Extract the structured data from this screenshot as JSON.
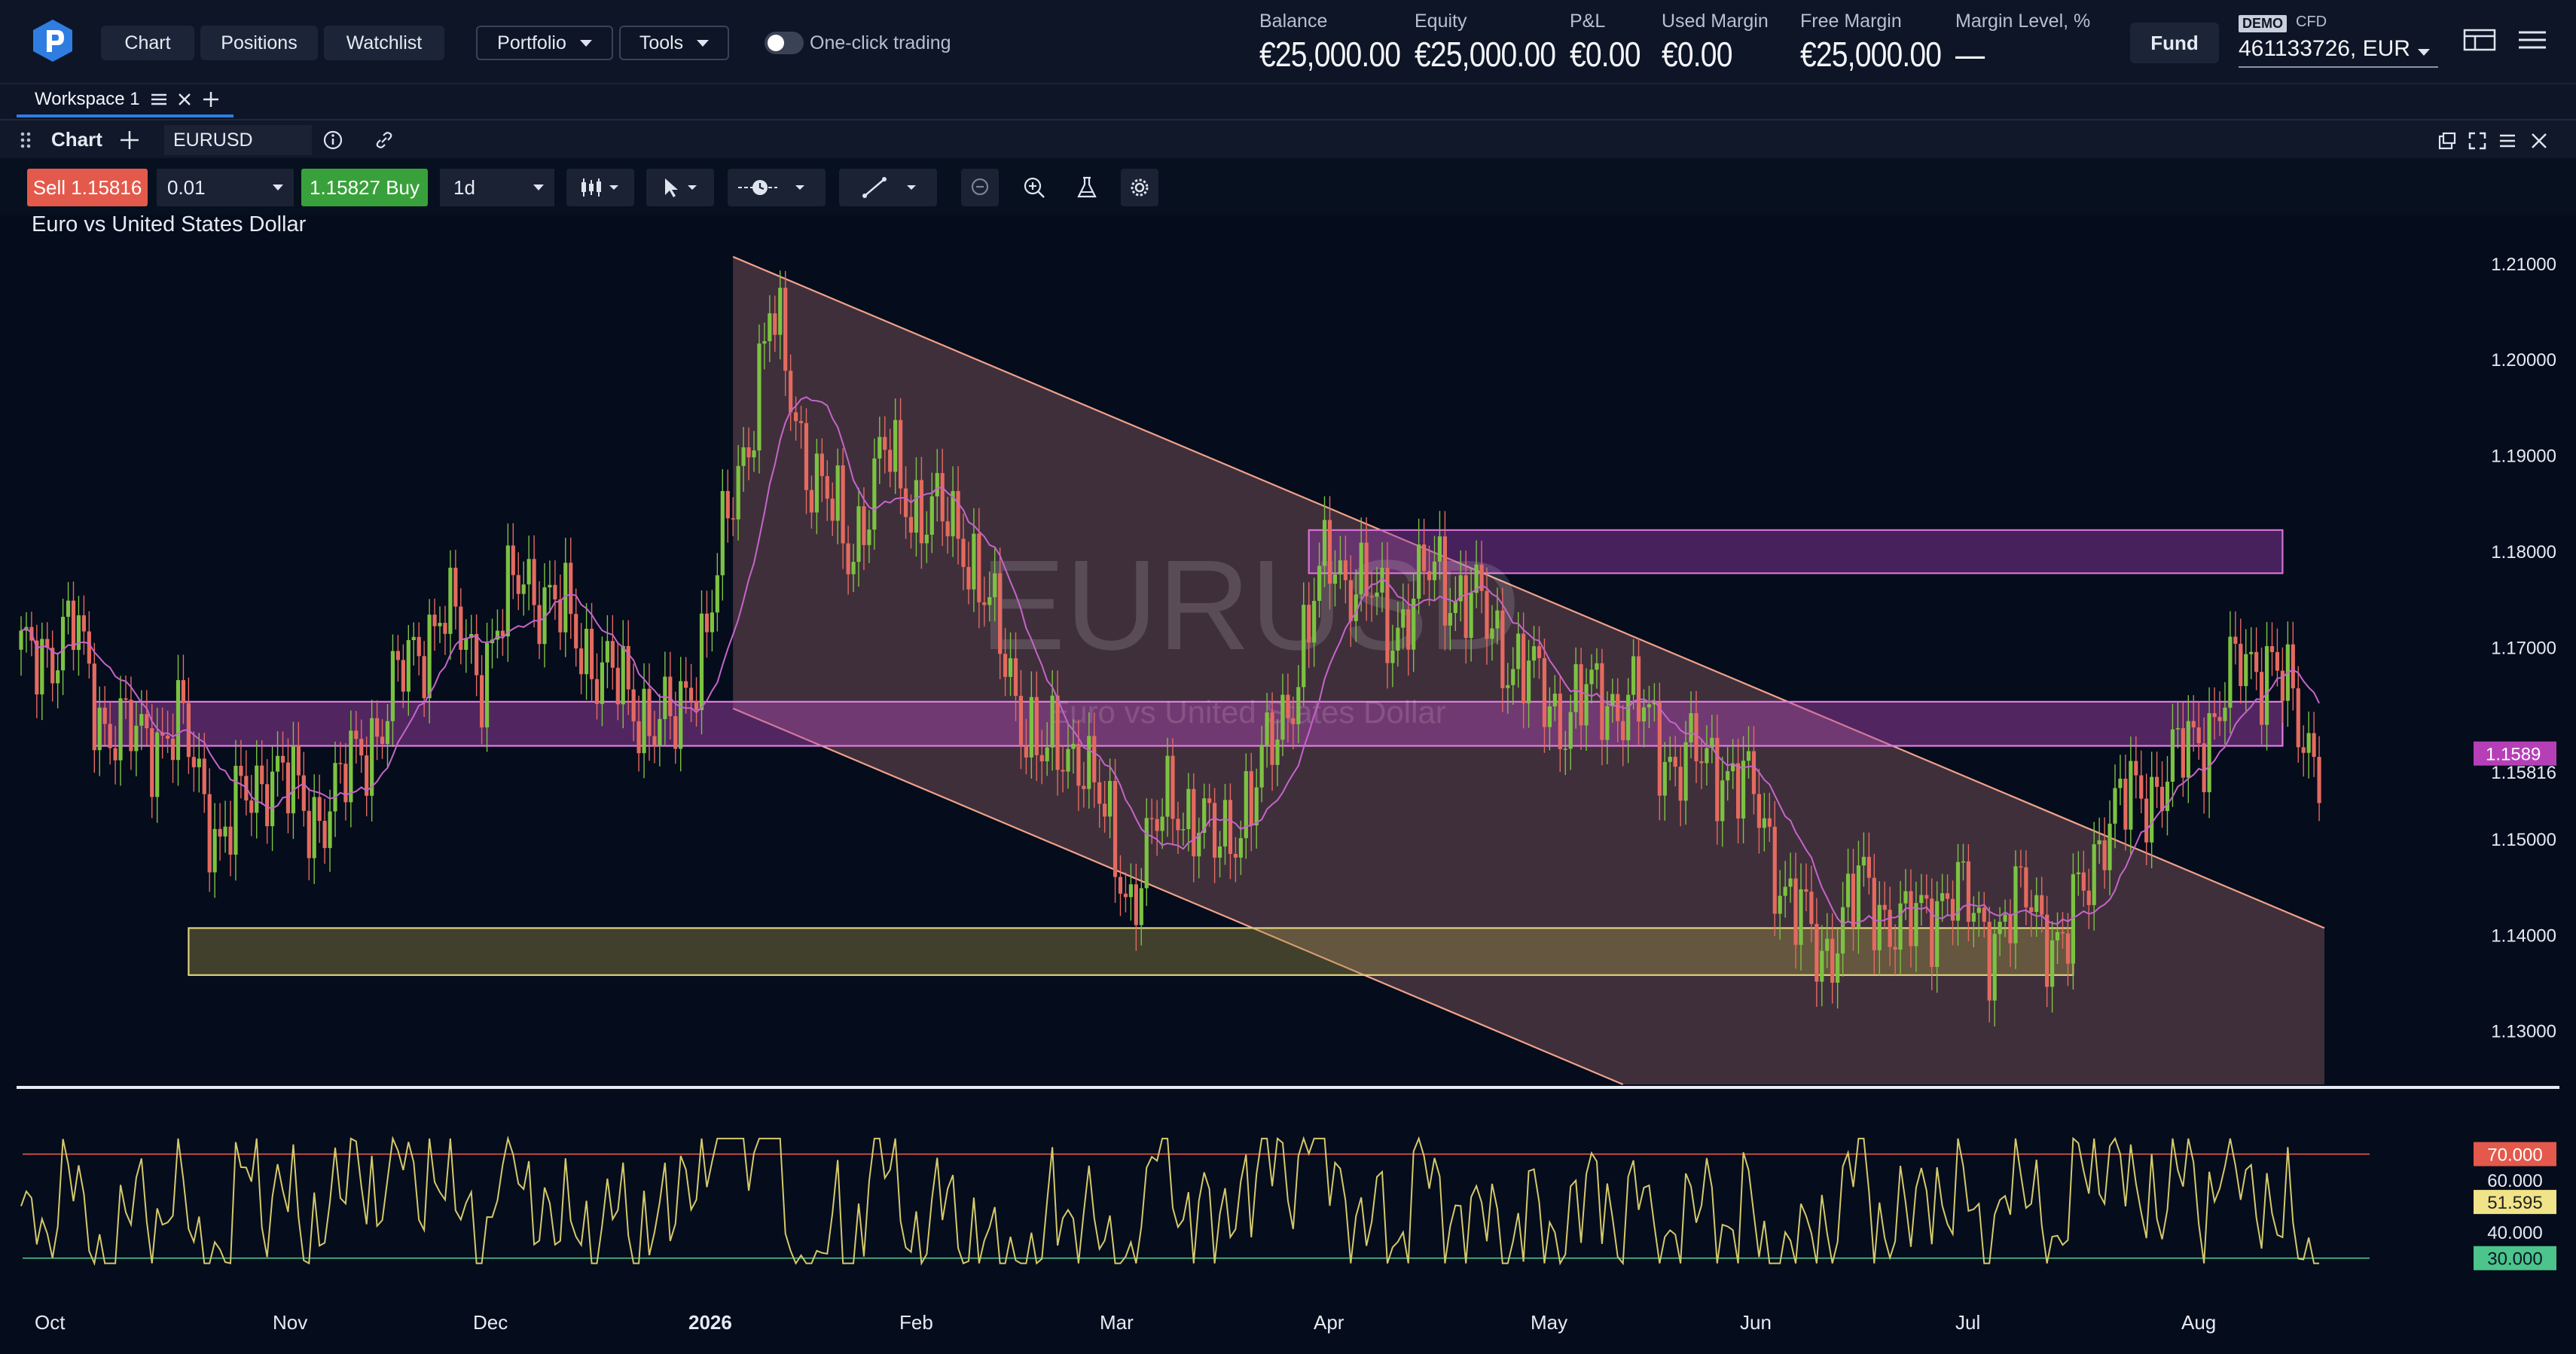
{
  "nav": {
    "chart": "Chart",
    "positions": "Positions",
    "watchlist": "Watchlist",
    "portfolio": "Portfolio",
    "tools": "Tools",
    "one_click": "One-click trading"
  },
  "account": [
    {
      "label": "Balance",
      "value": "€25,000.00"
    },
    {
      "label": "Equity",
      "value": "€25,000.00"
    },
    {
      "label": "P&L",
      "value": "€0.00"
    },
    {
      "label": "Used Margin",
      "value": "€0.00"
    },
    {
      "label": "Free Margin",
      "value": "€25,000.00"
    },
    {
      "label": "Margin Level, %",
      "value": "—"
    }
  ],
  "fund_label": "Fund",
  "demo_label": "DEMO",
  "cfd_label": "CFD",
  "account_id": "461133726, EUR",
  "workspace": {
    "tab": "Workspace 1"
  },
  "chart_header": {
    "label": "Chart",
    "symbol": "EURUSD"
  },
  "trade": {
    "sell_label": "Sell",
    "sell_price": "1.15816",
    "qty": "0.01",
    "buy_price": "1.15827",
    "buy_label": "Buy",
    "timeframe": "1d"
  },
  "chart_title": "Euro vs United States Dollar",
  "watermark": {
    "symbol": "EURUSD",
    "name": "Euro vs United States Dollar"
  },
  "colors": {
    "up": "#7cc242",
    "down": "#e46a5f",
    "ma": "#c565c9",
    "rsi": "#d4c96a",
    "channel": "#f1a18a",
    "zone_pink": "#d45fd2",
    "zone_yellow": "#d4c96a",
    "bg": "#050c1c"
  },
  "chart_data": {
    "type": "candlestick",
    "symbol": "EURUSD",
    "timeframe": "1d",
    "y_ticks": [
      "1.21000",
      "1.20000",
      "1.19000",
      "1.18000",
      "1.17000",
      "1.15000",
      "1.14000",
      "1.13000"
    ],
    "ylim": [
      1.1244,
      1.2147
    ],
    "x_ticks": [
      "Oct",
      "Nov",
      "Dec",
      "2026",
      "Feb",
      "Mar",
      "Apr",
      "May",
      "Jun",
      "Jul",
      "Aug"
    ],
    "current_price": {
      "bid": "1.15816",
      "label": "1.1589"
    },
    "close_path": [
      [
        0,
        1.168
      ],
      [
        10,
        1.172
      ],
      [
        15,
        1.163
      ],
      [
        22,
        1.16
      ],
      [
        30,
        1.162
      ],
      [
        38,
        1.15
      ],
      [
        48,
        1.158
      ],
      [
        55,
        1.152
      ],
      [
        62,
        1.156
      ],
      [
        70,
        1.164
      ],
      [
        80,
        1.174
      ],
      [
        88,
        1.168
      ],
      [
        96,
        1.178
      ],
      [
        105,
        1.172
      ],
      [
        115,
        1.165
      ],
      [
        125,
        1.161
      ],
      [
        132,
        1.175
      ],
      [
        138,
        1.19
      ],
      [
        143,
        1.205
      ],
      [
        150,
        1.19
      ],
      [
        158,
        1.18
      ],
      [
        165,
        1.19
      ],
      [
        172,
        1.184
      ],
      [
        180,
        1.182
      ],
      [
        187,
        1.17
      ],
      [
        195,
        1.158
      ],
      [
        202,
        1.16
      ],
      [
        208,
        1.15
      ],
      [
        212,
        1.144
      ],
      [
        220,
        1.155
      ],
      [
        228,
        1.149
      ],
      [
        236,
        1.155
      ],
      [
        244,
        1.168
      ],
      [
        250,
        1.18
      ],
      [
        256,
        1.176
      ],
      [
        262,
        1.172
      ],
      [
        270,
        1.178
      ],
      [
        278,
        1.174
      ],
      [
        286,
        1.168
      ],
      [
        294,
        1.163
      ],
      [
        302,
        1.165
      ],
      [
        308,
        1.164
      ],
      [
        316,
        1.158
      ],
      [
        325,
        1.158
      ],
      [
        332,
        1.153
      ],
      [
        338,
        1.143
      ],
      [
        344,
        1.138
      ],
      [
        352,
        1.145
      ],
      [
        360,
        1.14
      ],
      [
        368,
        1.145
      ],
      [
        376,
        1.14
      ],
      [
        384,
        1.144
      ],
      [
        390,
        1.138
      ],
      [
        398,
        1.152
      ],
      [
        406,
        1.155
      ],
      [
        412,
        1.158
      ],
      [
        418,
        1.162
      ],
      [
        424,
        1.168
      ],
      [
        430,
        1.169
      ],
      [
        436,
        1.16
      ]
    ],
    "rsi": {
      "levels": [
        "70.000",
        "60.000",
        "40.000",
        "30.000"
      ],
      "current": "51.595"
    },
    "drawings": {
      "channel_upper": [
        [
          136,
          1.2107
        ],
        [
          440,
          1.1407
        ]
      ],
      "channel_lower": [
        [
          136,
          1.1636
        ],
        [
          440,
          1.0935
        ]
      ],
      "zone_resistance": [
        246,
        432,
        1.1777,
        1.1822
      ],
      "zone_mid": [
        14,
        432,
        1.1597,
        1.1643
      ],
      "zone_support": [
        32,
        392,
        1.1358,
        1.1407
      ]
    }
  }
}
